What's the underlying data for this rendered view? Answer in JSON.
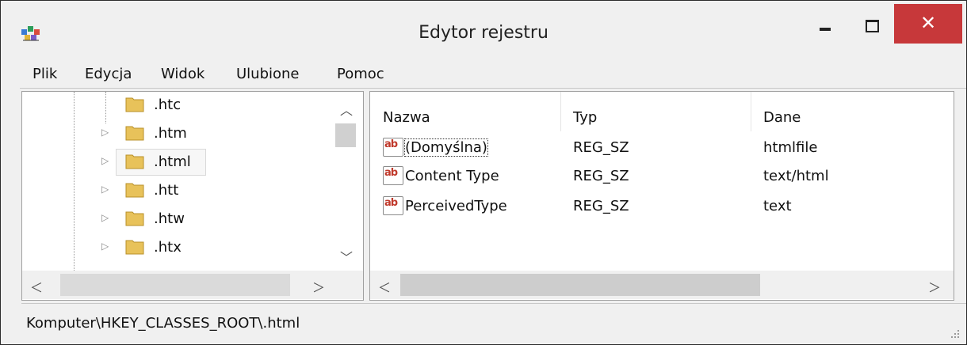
{
  "window": {
    "title": "Edytor rejestru",
    "controls": {
      "close_glyph": "✕"
    }
  },
  "menu": [
    {
      "label": "Plik"
    },
    {
      "label": "Edycja"
    },
    {
      "label": "Widok"
    },
    {
      "label": "Ulubione"
    },
    {
      "label": "Pomoc"
    }
  ],
  "tree": {
    "items": [
      {
        "label": ".htc",
        "has_children": false
      },
      {
        "label": ".htm",
        "has_children": true
      },
      {
        "label": ".html",
        "has_children": true,
        "selected": true
      },
      {
        "label": ".htt",
        "has_children": true
      },
      {
        "label": ".htw",
        "has_children": true
      },
      {
        "label": ".htx",
        "has_children": true
      }
    ]
  },
  "list": {
    "columns": [
      {
        "label": "Nazwa"
      },
      {
        "label": "Typ"
      },
      {
        "label": "Dane"
      }
    ],
    "rows": [
      {
        "name": "(Domyślna)",
        "type": "REG_SZ",
        "data": "htmlfile",
        "icon": "string-value-icon"
      },
      {
        "name": "Content Type",
        "type": "REG_SZ",
        "data": "text/html",
        "icon": "string-value-icon"
      },
      {
        "name": "PerceivedType",
        "type": "REG_SZ",
        "data": "text",
        "icon": "string-value-icon"
      }
    ]
  },
  "status": {
    "path": "Komputer\\HKEY_CLASSES_ROOT\\.html"
  },
  "colors": {
    "close_button": "#c7383a",
    "folder": "#e8c25a",
    "ab_red": "#c0392b"
  }
}
